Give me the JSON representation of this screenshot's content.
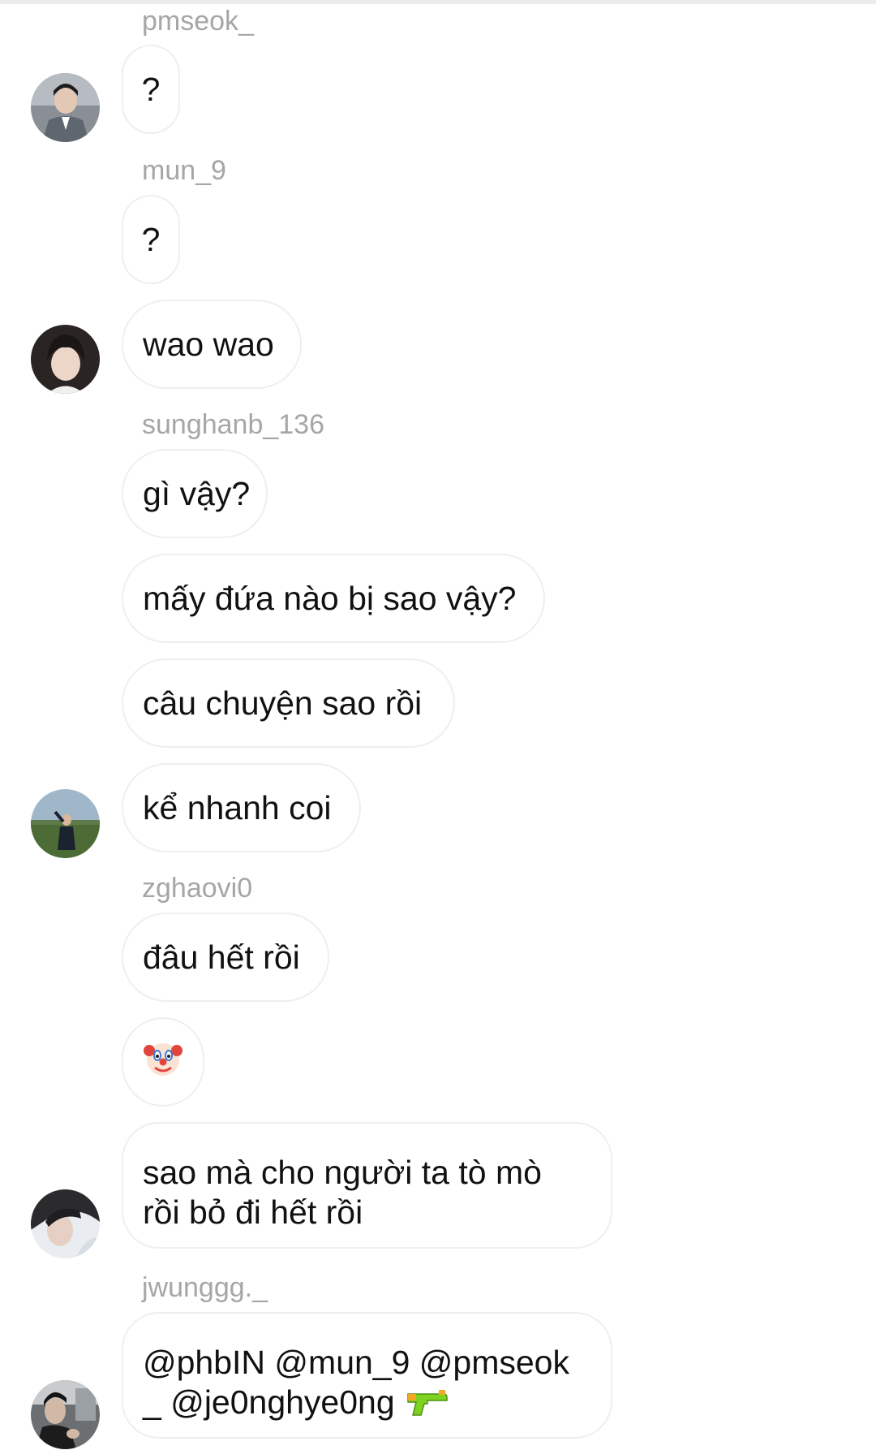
{
  "conversation": {
    "usernames": {
      "u1": "pmseok_",
      "u2": "mun_9",
      "u3": "sunghanb_136",
      "u4": "zghaovi0",
      "u5": "jwunggg._"
    },
    "messages": {
      "m1": "?",
      "m2": "?",
      "m3": "wao wao",
      "m4": "gì vậy?",
      "m5": "mấy đứa nào bị sao vậy?",
      "m6": "câu chuyện sao rồi",
      "m7": "kể nhanh coi",
      "m8": "đâu hết rồi",
      "m9": "clown-face-emoji",
      "m10_line1": "sao mà cho người ta tò mò",
      "m10_line2": "rồi bỏ đi hết rồi",
      "m11_line1": "@phbIN @mun_9 @pmseok",
      "m11_line2": "_ @je0nghye0ng",
      "m11_icon": "water-pistol-emoji"
    }
  },
  "colors": {
    "bubble_border": "#efefef",
    "username": "#a6a6a6",
    "text": "#111111"
  }
}
